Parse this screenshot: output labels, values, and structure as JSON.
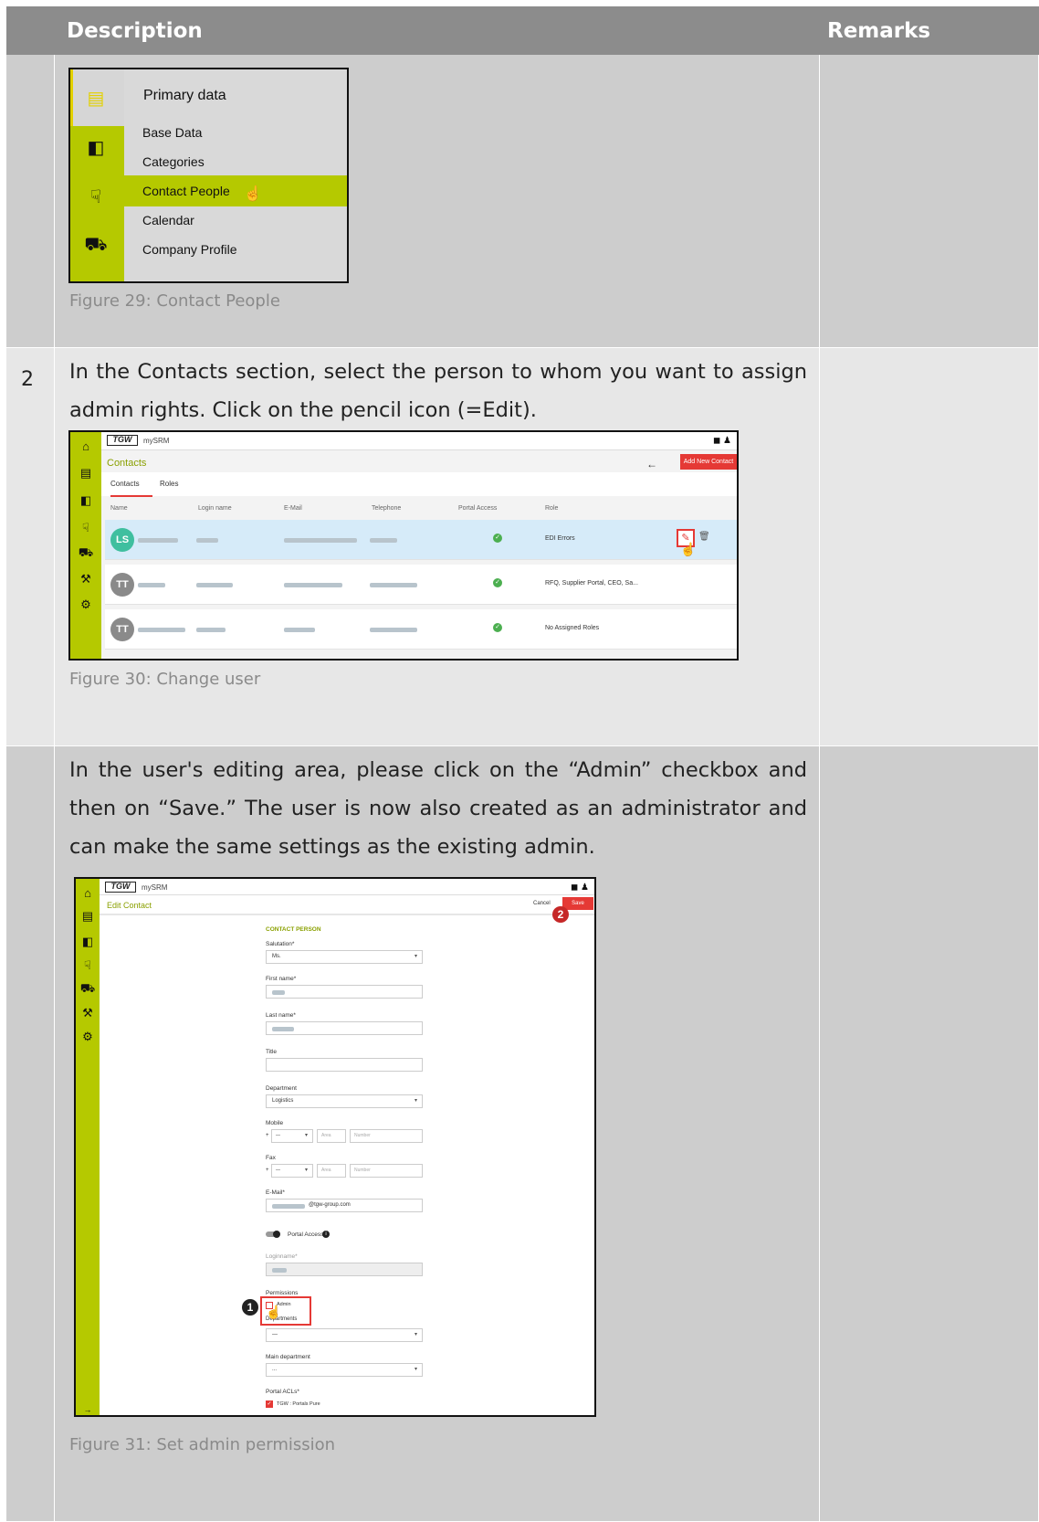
{
  "header": {
    "description": "Description",
    "remarks": "Remarks"
  },
  "row1": {
    "figure": {
      "menu_title": "Primary data",
      "items": [
        "Base Data",
        "Categories",
        "Contact People",
        "Calendar",
        "Company Profile"
      ],
      "selected": "Contact People"
    },
    "caption": "Figure 29: Contact People"
  },
  "row2": {
    "number": "2",
    "text": "In the Contacts section, select the person to whom you want to assign admin rights. Click on the pencil icon (=Edit).",
    "figure": {
      "logo": "TGW",
      "brand": "mySRM",
      "title": "Contacts",
      "add_button": "Add New Contact",
      "tabs": [
        "Contacts",
        "Roles"
      ],
      "columns": [
        "Name",
        "Login name",
        "E-Mail",
        "Telephone",
        "Portal Access",
        "Role"
      ],
      "rows": [
        {
          "initials": "LS",
          "role": "EDI Errors"
        },
        {
          "initials": "TT",
          "role": "RFQ, Supplier Portal, CEO, Sa..."
        },
        {
          "initials": "TT",
          "role": "No Assigned Roles"
        }
      ]
    },
    "caption": "Figure 30: Change user"
  },
  "row3": {
    "text": "In the user's editing area, please click on the “Admin” checkbox and then on “Save.” The user is now also created as an administrator and can make the same settings as the existing admin.",
    "figure": {
      "logo": "TGW",
      "brand": "mySRM",
      "title": "Edit Contact",
      "cancel": "Cancel",
      "save": "Save",
      "section": "CONTACT PERSON",
      "salutation_label": "Salutation*",
      "salutation_value": "Ms.",
      "first_name_label": "First name*",
      "last_name_label": "Last name*",
      "title_label": "Title",
      "department_label": "Department",
      "department_value": "Logistics",
      "mobile_label": "Mobile",
      "fax_label": "Fax",
      "phone_prefix": "+",
      "phone_code": "—",
      "area_placeholder": "Area",
      "number_placeholder": "Number",
      "email_label": "E-Mail*",
      "email_value": "@tgw-group.com",
      "portal_access": "Portal Access",
      "loginname_label": "Loginname*",
      "permissions_label": "Permissions",
      "admin_label": "Admin",
      "departments_label": "Departments",
      "departments_value": "—",
      "main_department_label": "Main department",
      "main_department_value": "...",
      "portal_acls_label": "Portal ACLs*",
      "portal_acls_value": "TGW : Portals Pure",
      "badge1": "1",
      "badge2": "2"
    },
    "caption": "Figure 31: Set admin permission"
  },
  "colors": {
    "accent_green": "#b5c900",
    "accent_red": "#e53935"
  }
}
